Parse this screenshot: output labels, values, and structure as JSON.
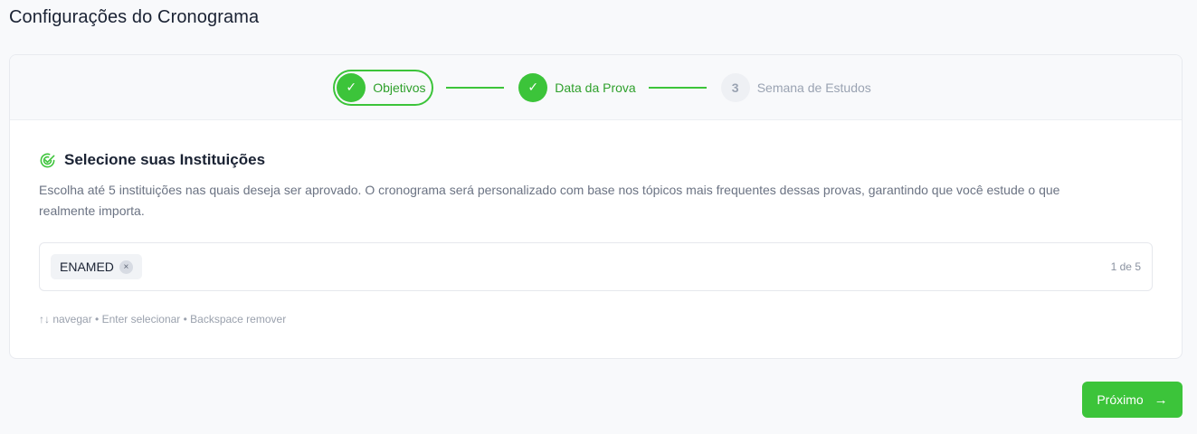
{
  "page": {
    "title": "Configurações do Cronograma"
  },
  "stepper": {
    "steps": [
      {
        "label": "Objetivos",
        "marker": "✓",
        "state": "done-active"
      },
      {
        "label": "Data da Prova",
        "marker": "✓",
        "state": "done"
      },
      {
        "label": "Semana de Estudos",
        "marker": "3",
        "state": "pending"
      }
    ]
  },
  "section": {
    "title": "Selecione suas Instituições",
    "icon": "target-check-icon",
    "description": "Escolha até 5 instituições nas quais deseja ser aprovado. O cronograma será personalizado com base nos tópicos mais frequentes dessas provas, garantindo que você estude o que realmente importa."
  },
  "selector": {
    "chips": [
      {
        "label": "ENAMED",
        "remove_glyph": "×"
      }
    ],
    "counter": "1 de 5"
  },
  "hint": "↑↓ navegar • Enter selecionar • Backspace remover",
  "footer": {
    "next_label": "Próximo",
    "next_arrow": "→"
  },
  "colors": {
    "accent": "#3cc43a",
    "accent_text": "#2fa02c",
    "muted": "#9aa3b2"
  }
}
